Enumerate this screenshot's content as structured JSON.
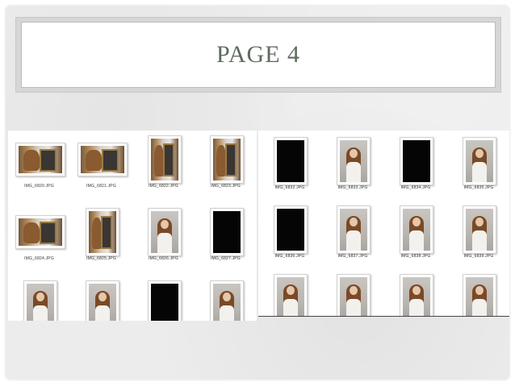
{
  "slide": {
    "title": "PAGE 4"
  },
  "left_panel": {
    "items": [
      {
        "caption": "IMG_6820.JPG",
        "kind": "mirror-land"
      },
      {
        "caption": "IMG_6821.JPG",
        "kind": "mirror-land"
      },
      {
        "caption": "IMG_6822.JPG",
        "kind": "mirror-port"
      },
      {
        "caption": "IMG_6823.JPG",
        "kind": "mirror-port"
      },
      {
        "caption": "IMG_6824.JPG",
        "kind": "mirror-land"
      },
      {
        "caption": "IMG_6825.JPG",
        "kind": "mirror-port"
      },
      {
        "caption": "IMG_6826.JPG",
        "kind": "portrait"
      },
      {
        "caption": "IMG_6827.JPG",
        "kind": "black"
      },
      {
        "caption": "",
        "kind": "portrait"
      },
      {
        "caption": "",
        "kind": "portrait"
      },
      {
        "caption": "",
        "kind": "black"
      },
      {
        "caption": "",
        "kind": "portrait"
      }
    ]
  },
  "right_panel": {
    "items": [
      {
        "caption": "IMG_6832.JPG",
        "kind": "black"
      },
      {
        "caption": "IMG_6833.JPG",
        "kind": "portrait"
      },
      {
        "caption": "IMG_6834.JPG",
        "kind": "black"
      },
      {
        "caption": "IMG_6835.JPG",
        "kind": "portrait"
      },
      {
        "caption": "IMG_6836.JPG",
        "kind": "black"
      },
      {
        "caption": "IMG_6837.JPG",
        "kind": "portrait"
      },
      {
        "caption": "IMG_6838.JPG",
        "kind": "portrait"
      },
      {
        "caption": "IMG_6839.JPG",
        "kind": "portrait"
      },
      {
        "caption": "",
        "kind": "portrait"
      },
      {
        "caption": "",
        "kind": "portrait"
      },
      {
        "caption": "",
        "kind": "portrait"
      },
      {
        "caption": "",
        "kind": "portrait"
      }
    ]
  }
}
